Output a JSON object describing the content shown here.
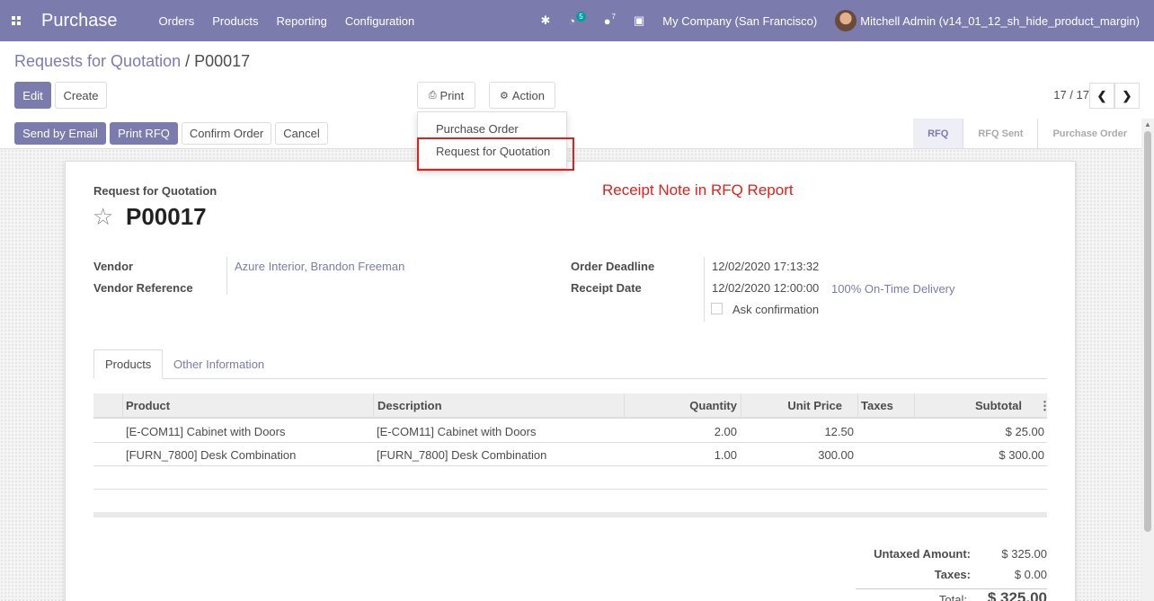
{
  "navbar": {
    "app_title": "Purchase",
    "menu": [
      "Orders",
      "Products",
      "Reporting",
      "Configuration"
    ],
    "activity_count": "5",
    "message_count": "7",
    "company": "My Company (San Francisco)",
    "user": "Mitchell Admin (v14_01_12_sh_hide_product_margin)"
  },
  "breadcrumb": {
    "parent": "Requests for Quotation",
    "separator": " / ",
    "current": "P00017"
  },
  "toolbar": {
    "edit": "Edit",
    "create": "Create",
    "print": "Print",
    "action": "Action"
  },
  "pager": {
    "value": "17 / 17"
  },
  "print_menu": {
    "items": [
      "Purchase Order",
      "Request for Quotation"
    ]
  },
  "header_buttons": {
    "send_email": "Send by Email",
    "print_rfq": "Print RFQ",
    "confirm": "Confirm Order",
    "cancel": "Cancel"
  },
  "status_steps": [
    "RFQ",
    "RFQ Sent",
    "Purchase Order"
  ],
  "annotation": "Receipt Note in RFQ Report",
  "document": {
    "label": "Request for Quotation",
    "name": "P00017",
    "vendor_label": "Vendor",
    "vendor_value": "Azure Interior, Brandon Freeman",
    "vendor_ref_label": "Vendor Reference",
    "deadline_label": "Order Deadline",
    "deadline_value": "12/02/2020 17:13:32",
    "receipt_label": "Receipt Date",
    "receipt_value": "12/02/2020 12:00:00",
    "on_time": "100% On-Time Delivery",
    "ask_confirmation": "Ask confirmation"
  },
  "tabs": [
    "Products",
    "Other Information"
  ],
  "table": {
    "headers": [
      "Product",
      "Description",
      "Quantity",
      "Unit Price",
      "Taxes",
      "Subtotal"
    ],
    "rows": [
      [
        "[E-COM11] Cabinet with Doors",
        "[E-COM11] Cabinet with Doors",
        "2.00",
        "12.50",
        "",
        "$ 25.00"
      ],
      [
        "[FURN_7800] Desk Combination",
        "[FURN_7800] Desk Combination",
        "1.00",
        "300.00",
        "",
        "$ 300.00"
      ]
    ]
  },
  "totals": {
    "untaxed_label": "Untaxed Amount:",
    "untaxed_value": "$ 325.00",
    "taxes_label": "Taxes:",
    "taxes_value": "$ 0.00",
    "total_label": "Total:",
    "total_value": "$ 325.00"
  },
  "colors": {
    "brand": "#7c7bad",
    "annotation": "#e0201b"
  }
}
